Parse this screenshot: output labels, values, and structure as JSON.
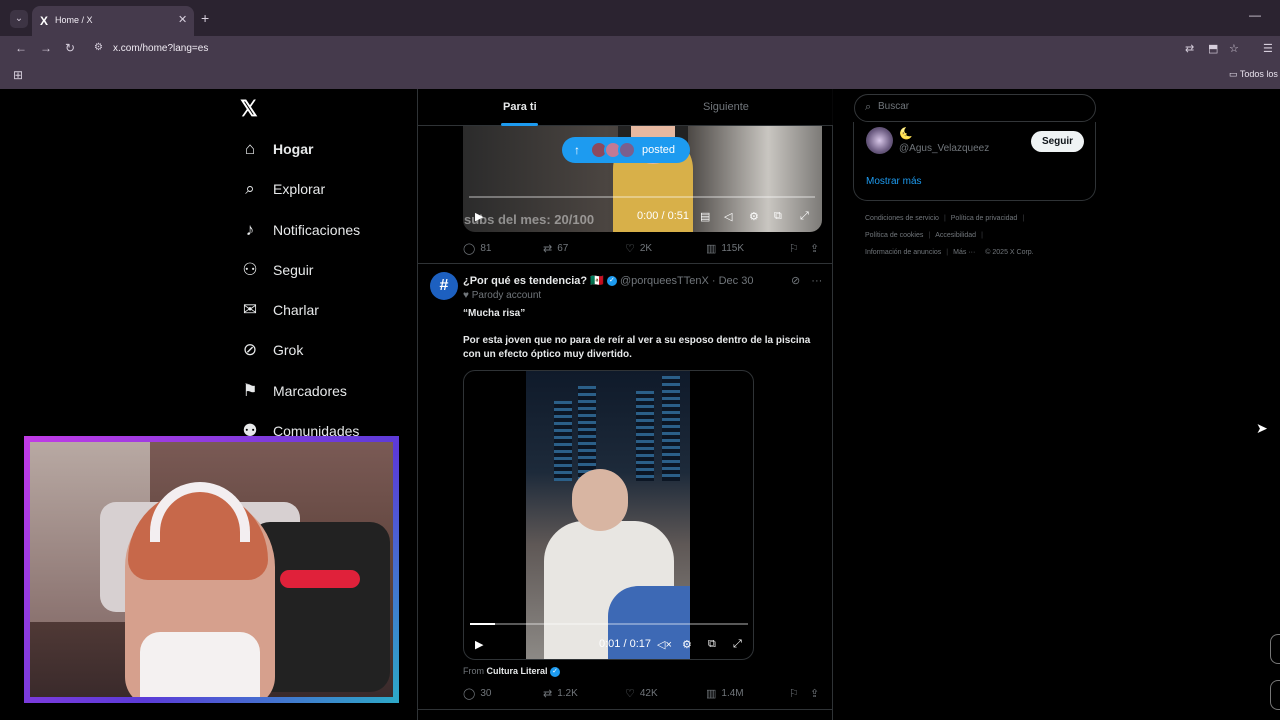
{
  "browser": {
    "tab_title": "Home / X",
    "tab_favicon": "X",
    "close_tab": "✕",
    "new_tab": "+",
    "url": "x.com/home?lang=es",
    "bookmark_folder": "Todos los"
  },
  "sidebar": {
    "logo": "𝕏",
    "items": [
      {
        "label": "Hogar",
        "icon": "home-icon"
      },
      {
        "label": "Explorar",
        "icon": "search-icon"
      },
      {
        "label": "Notificaciones",
        "icon": "bell-icon"
      },
      {
        "label": "Seguir",
        "icon": "add-user-icon"
      },
      {
        "label": "Charlar",
        "icon": "mail-icon"
      },
      {
        "label": "Grok",
        "icon": "grok-icon"
      },
      {
        "label": "Marcadores",
        "icon": "bookmark-icon"
      },
      {
        "label": "Comunidades",
        "icon": "people-icon"
      }
    ]
  },
  "feed": {
    "tabs": [
      "Para ti",
      "Siguiente"
    ],
    "posted_pill": "posted",
    "video1": {
      "subs_text": "subs del mes: 20/100",
      "time": "0:00 / 0:51"
    },
    "tweet1_actions": {
      "replies": "81",
      "retweets": "67",
      "likes": "2K",
      "views": "115K"
    },
    "tweet2": {
      "name": "¿Por qué es tendencia?",
      "flag": "🇲🇽",
      "handle": "@porqueesTTenX",
      "date": "· Dec 30",
      "parody": "Parody account",
      "quote": "“Mucha risa”",
      "body": "Por esta joven que no para de reír al ver a su esposo dentro de la piscina con un efecto óptico muy divertido.",
      "video_time": "0:01 / 0:17",
      "from_label": "From",
      "from_source": "Cultura Literal",
      "actions": {
        "replies": "30",
        "retweets": "1.2K",
        "likes": "42K",
        "views": "1.4M"
      }
    }
  },
  "right": {
    "search_placeholder": "Buscar",
    "suggestion_emoji": "🌜",
    "suggestion_handle": "@Agus_Velazqueez",
    "follow_label": "Seguir",
    "show_more": "Mostrar más",
    "footer_line1": [
      "Condiciones de servicio",
      "Política de privacidad"
    ],
    "footer_line2": [
      "Política de cookies",
      "Accesibilidad"
    ],
    "footer_line3": [
      "Información de anuncios",
      "Más ···",
      "© 2025 X Corp."
    ]
  },
  "colors": {
    "accent": "#1d9bf0",
    "chrome": "#453a4c",
    "background": "#000000"
  }
}
